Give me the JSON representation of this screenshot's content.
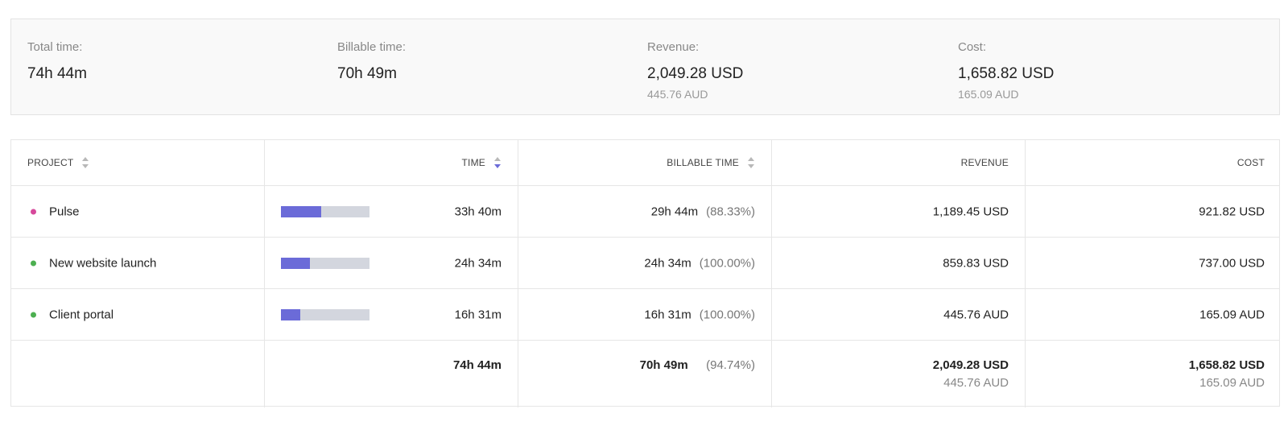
{
  "summary": {
    "total_time": {
      "label": "Total time:",
      "value": "74h 44m"
    },
    "billable_time": {
      "label": "Billable time:",
      "value": "70h 49m"
    },
    "revenue": {
      "label": "Revenue:",
      "value": "2,049.28 USD",
      "sub": "445.76 AUD"
    },
    "cost": {
      "label": "Cost:",
      "value": "1,658.82 USD",
      "sub": "165.09 AUD"
    }
  },
  "table": {
    "headers": {
      "project": "PROJECT",
      "time": "TIME",
      "billable_time": "BILLABLE TIME",
      "revenue": "REVENUE",
      "cost": "COST"
    },
    "rows": [
      {
        "project": "Pulse",
        "dot_color": "#d6489b",
        "time_fraction": 0.45,
        "time": "33h 40m",
        "billable": "29h 44m",
        "billable_pct": "(88.33%)",
        "revenue": "1,189.45 USD",
        "cost": "921.82 USD"
      },
      {
        "project": "New website launch",
        "dot_color": "#4caf50",
        "time_fraction": 0.33,
        "time": "24h 34m",
        "billable": "24h 34m",
        "billable_pct": "(100.00%)",
        "revenue": "859.83 USD",
        "cost": "737.00 USD"
      },
      {
        "project": "Client portal",
        "dot_color": "#4caf50",
        "time_fraction": 0.22,
        "time": "16h 31m",
        "billable": "16h 31m",
        "billable_pct": "(100.00%)",
        "revenue": "445.76 AUD",
        "cost": "165.09 AUD"
      }
    ],
    "totals": {
      "time": "74h 44m",
      "billable": "70h 49m",
      "billable_pct": "(94.74%)",
      "revenue": "2,049.28 USD",
      "revenue_sub": "445.76 AUD",
      "cost": "1,658.82 USD",
      "cost_sub": "165.09 AUD"
    }
  },
  "colors": {
    "accent": "#6b6bd8",
    "bar_track": "#d3d6de"
  }
}
